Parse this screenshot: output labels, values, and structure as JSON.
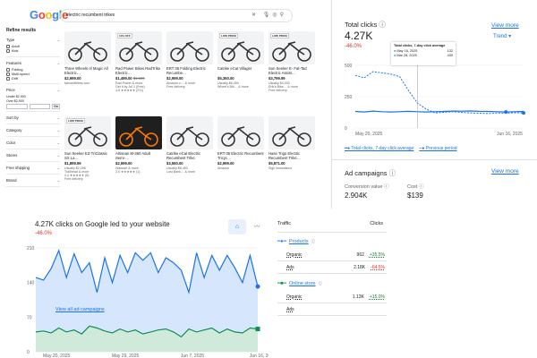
{
  "shop": {
    "query": "electric recumbent trikes",
    "refine_title": "Refine results",
    "filters": [
      {
        "label": "Type",
        "options": [
          "Adult",
          "Kids"
        ]
      },
      {
        "label": "Features",
        "options": [
          "Folding",
          "Multi-speed",
          "Drift"
        ]
      },
      {
        "label": "Price",
        "options": [
          "Under $2,900",
          "Over $2,900"
        ]
      },
      {
        "label": "Sort by",
        "options": []
      },
      {
        "label": "Category",
        "options": []
      },
      {
        "label": "Color",
        "options": []
      },
      {
        "label": "Stores",
        "options": []
      },
      {
        "label": "Free shipping",
        "options": []
      },
      {
        "label": "Brand",
        "options": []
      }
    ],
    "price_go": "Go",
    "products": [
      {
        "badge": "",
        "title": "Three Wheels of Magic All Electric…",
        "price": "$2,999.00",
        "old": "",
        "merchant": "tatooedtrikes.com",
        "delivery": "",
        "rating": "",
        "extra": ""
      },
      {
        "badge": "11% OFF",
        "title": "Rad Power Bikes RadTrike Electric…",
        "price": "$1,499.00",
        "old": "$1,699",
        "merchant": "Rad Power & more",
        "delivery": "Get it by Jul 1 (Free)",
        "rating": "4.6 ★★★★★ (211)",
        "extra": ""
      },
      {
        "badge": "",
        "title": "ERT 36 Folding Electric Recumbe…",
        "price": "$2,999.00",
        "old": "",
        "merchant": "Amazon.c… & more",
        "delivery": "Free delivery",
        "rating": "",
        "extra": ""
      },
      {
        "badge": "LOW PRICE",
        "title": "Catrike eCat Villager",
        "price": "$5,350.00",
        "old": "",
        "merchant": "Usually $6,450",
        "delivery": "Wheel's Bik… & more",
        "rating": "",
        "extra": ""
      },
      {
        "badge": "LOW PRICE",
        "title": "Sun Seeker E- Fat-Tad Electric Assist…",
        "price": "$3,799.99",
        "old": "",
        "merchant": "Usually $4,000",
        "delivery": "Erik's Bike… & more",
        "rating": "Free delivery",
        "extra": ""
      },
      {
        "badge": "LOW PRICE",
        "title": "Sun Seeker EZ-TriClassic SX La…",
        "price": "$1,899.99",
        "old": "",
        "merchant": "Usually $2,296",
        "delivery": "Trailhead & more",
        "rating": "4.4 ★★★★★ (6)",
        "extra": "Free delivery"
      },
      {
        "badge": "",
        "title": "Artisean M-360 Adult Semi-…",
        "price": "$2,999.00",
        "old": "",
        "merchant": "Walmart & more",
        "delivery": "3.0 ★★★★★ (1)",
        "rating": "",
        "extra": ""
      },
      {
        "badge": "",
        "title": "Catrike eCat Electric Recumbent Trike",
        "price": "$3,550.00",
        "old": "",
        "merchant": "Usually $6,450",
        "delivery": "Lost Bank… & more",
        "rating": "",
        "extra": ""
      },
      {
        "badge": "",
        "title": "ERT-36 Electric Recumbent Tricyc…",
        "price": "$2,999.00",
        "old": "",
        "merchant": "Amazon",
        "delivery": "",
        "rating": "",
        "extra": ""
      },
      {
        "badge": "",
        "title": "Hase Trigo Electric Recumbent Trike…",
        "price": "$5,871.00",
        "old": "",
        "merchant": "Sigil Innovations",
        "delivery": "",
        "rating": "",
        "extra": ""
      }
    ]
  },
  "total_clicks": {
    "title": "Total clicks",
    "value": "4.27K",
    "change": "-46.0%",
    "view_more": "View more",
    "trend": "Trend",
    "tooltip_title": "Total clicks, 7-day click average",
    "tooltip_rows": [
      {
        "label": "May 16, 2025",
        "value": "132"
      },
      {
        "label": "Mar 28, 2025",
        "value": "430"
      }
    ],
    "legend_current": "Total clicks, 7-day click average",
    "legend_previous": "Previous period",
    "x_start": "May 20, 2025",
    "x_end": "Jun 16, 2025",
    "y_ticks": [
      "500",
      "250",
      "0"
    ]
  },
  "ad_campaigns": {
    "title": "Ad campaigns",
    "view_more": "View more",
    "conv_label": "Conversion value",
    "conv_value": "2.904K",
    "cost_label": "Cost",
    "cost_value": "$139"
  },
  "bottom_chart": {
    "title": "4.27K clicks on Google led to your website",
    "change": "-46.0%",
    "y_ticks": [
      "210",
      "140",
      "70",
      "0"
    ],
    "x_ticks": [
      "May 20, 2025",
      "May 29, 2025",
      "Jun 7, 2025",
      "Jun 16, 2025"
    ]
  },
  "chart_data": {
    "type": "area",
    "x_start": "May 20, 2025",
    "x_end": "Jun 16, 2025",
    "ylim": [
      0,
      210
    ],
    "series": [
      {
        "name": "Products",
        "color": "#1a73e8",
        "values": [
          150,
          145,
          168,
          205,
          150,
          198,
          160,
          180,
          120,
          190,
          140,
          195,
          160,
          200,
          185,
          200,
          160,
          190,
          180,
          165,
          120,
          200,
          150,
          195,
          165,
          195,
          170,
          140,
          195,
          132
        ]
      },
      {
        "name": "Online store",
        "color": "#0d904f",
        "values": [
          40,
          42,
          38,
          48,
          40,
          44,
          36,
          52,
          48,
          42,
          38,
          46,
          40,
          44,
          36,
          40,
          44,
          46,
          40,
          30,
          46,
          40,
          44,
          48,
          38,
          46,
          40,
          38,
          48,
          46
        ]
      }
    ]
  },
  "traffic": {
    "header_left": "Traffic",
    "header_right": "Clicks",
    "sections": [
      {
        "name": "Products",
        "rows": [
          {
            "label": "Organic",
            "value": "962",
            "delta": "+35.5%",
            "dir": "up"
          },
          {
            "label": "Ads",
            "value": "2.18K",
            "delta": "-64.5%",
            "dir": "down"
          }
        ]
      },
      {
        "name": "Online store",
        "rows": [
          {
            "label": "Organic",
            "value": "1.13K",
            "delta": "+15.0%",
            "dir": "up"
          },
          {
            "label": "Ads",
            "value": "",
            "delta": "",
            "dir": ""
          }
        ]
      }
    ],
    "view_all": "View all ad campaigns"
  }
}
